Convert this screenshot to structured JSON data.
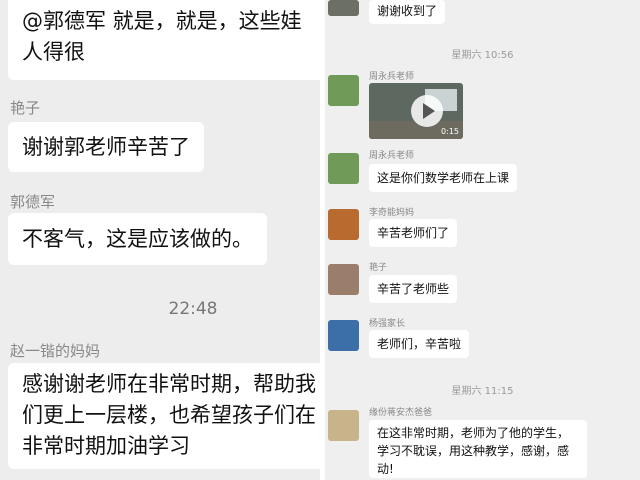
{
  "left": {
    "messages": [
      {
        "sender": "",
        "lines": [
          "@郭德军 就是，就是，这些娃",
          "人得很"
        ]
      },
      {
        "sender": "艳子",
        "lines": [
          "谢谢郭老师辛苦了"
        ]
      },
      {
        "sender": "郭德军",
        "lines": [
          "不客气，这是应该做的。"
        ]
      },
      {
        "sender": "赵一锴的妈妈",
        "lines": [
          "感谢谢老师在非常时期，帮助我",
          "们更上一层楼，也希望孩子们在",
          "非常时期加油学习"
        ]
      }
    ],
    "time": "22:48"
  },
  "right": {
    "top_message": "谢谢收到了",
    "time1": "星期六 10:56",
    "time2": "星期六 11:15",
    "video_duration": "0:15",
    "messages": [
      {
        "sender": "周永兵老师",
        "text": ""
      },
      {
        "sender": "周永兵老师",
        "text": "这是你们数学老师在上课"
      },
      {
        "sender": "李奇能妈妈",
        "text": "辛苦老师们了"
      },
      {
        "sender": "艳子",
        "text": "辛苦了老师些"
      },
      {
        "sender": "杨强家长",
        "text": "老师们，辛苦啦"
      },
      {
        "sender": "缘份蒋安杰爸爸",
        "text": "在这非常时期，老师为了他的学生，学习不耽误，用这种教学，感谢，感动!"
      }
    ]
  }
}
